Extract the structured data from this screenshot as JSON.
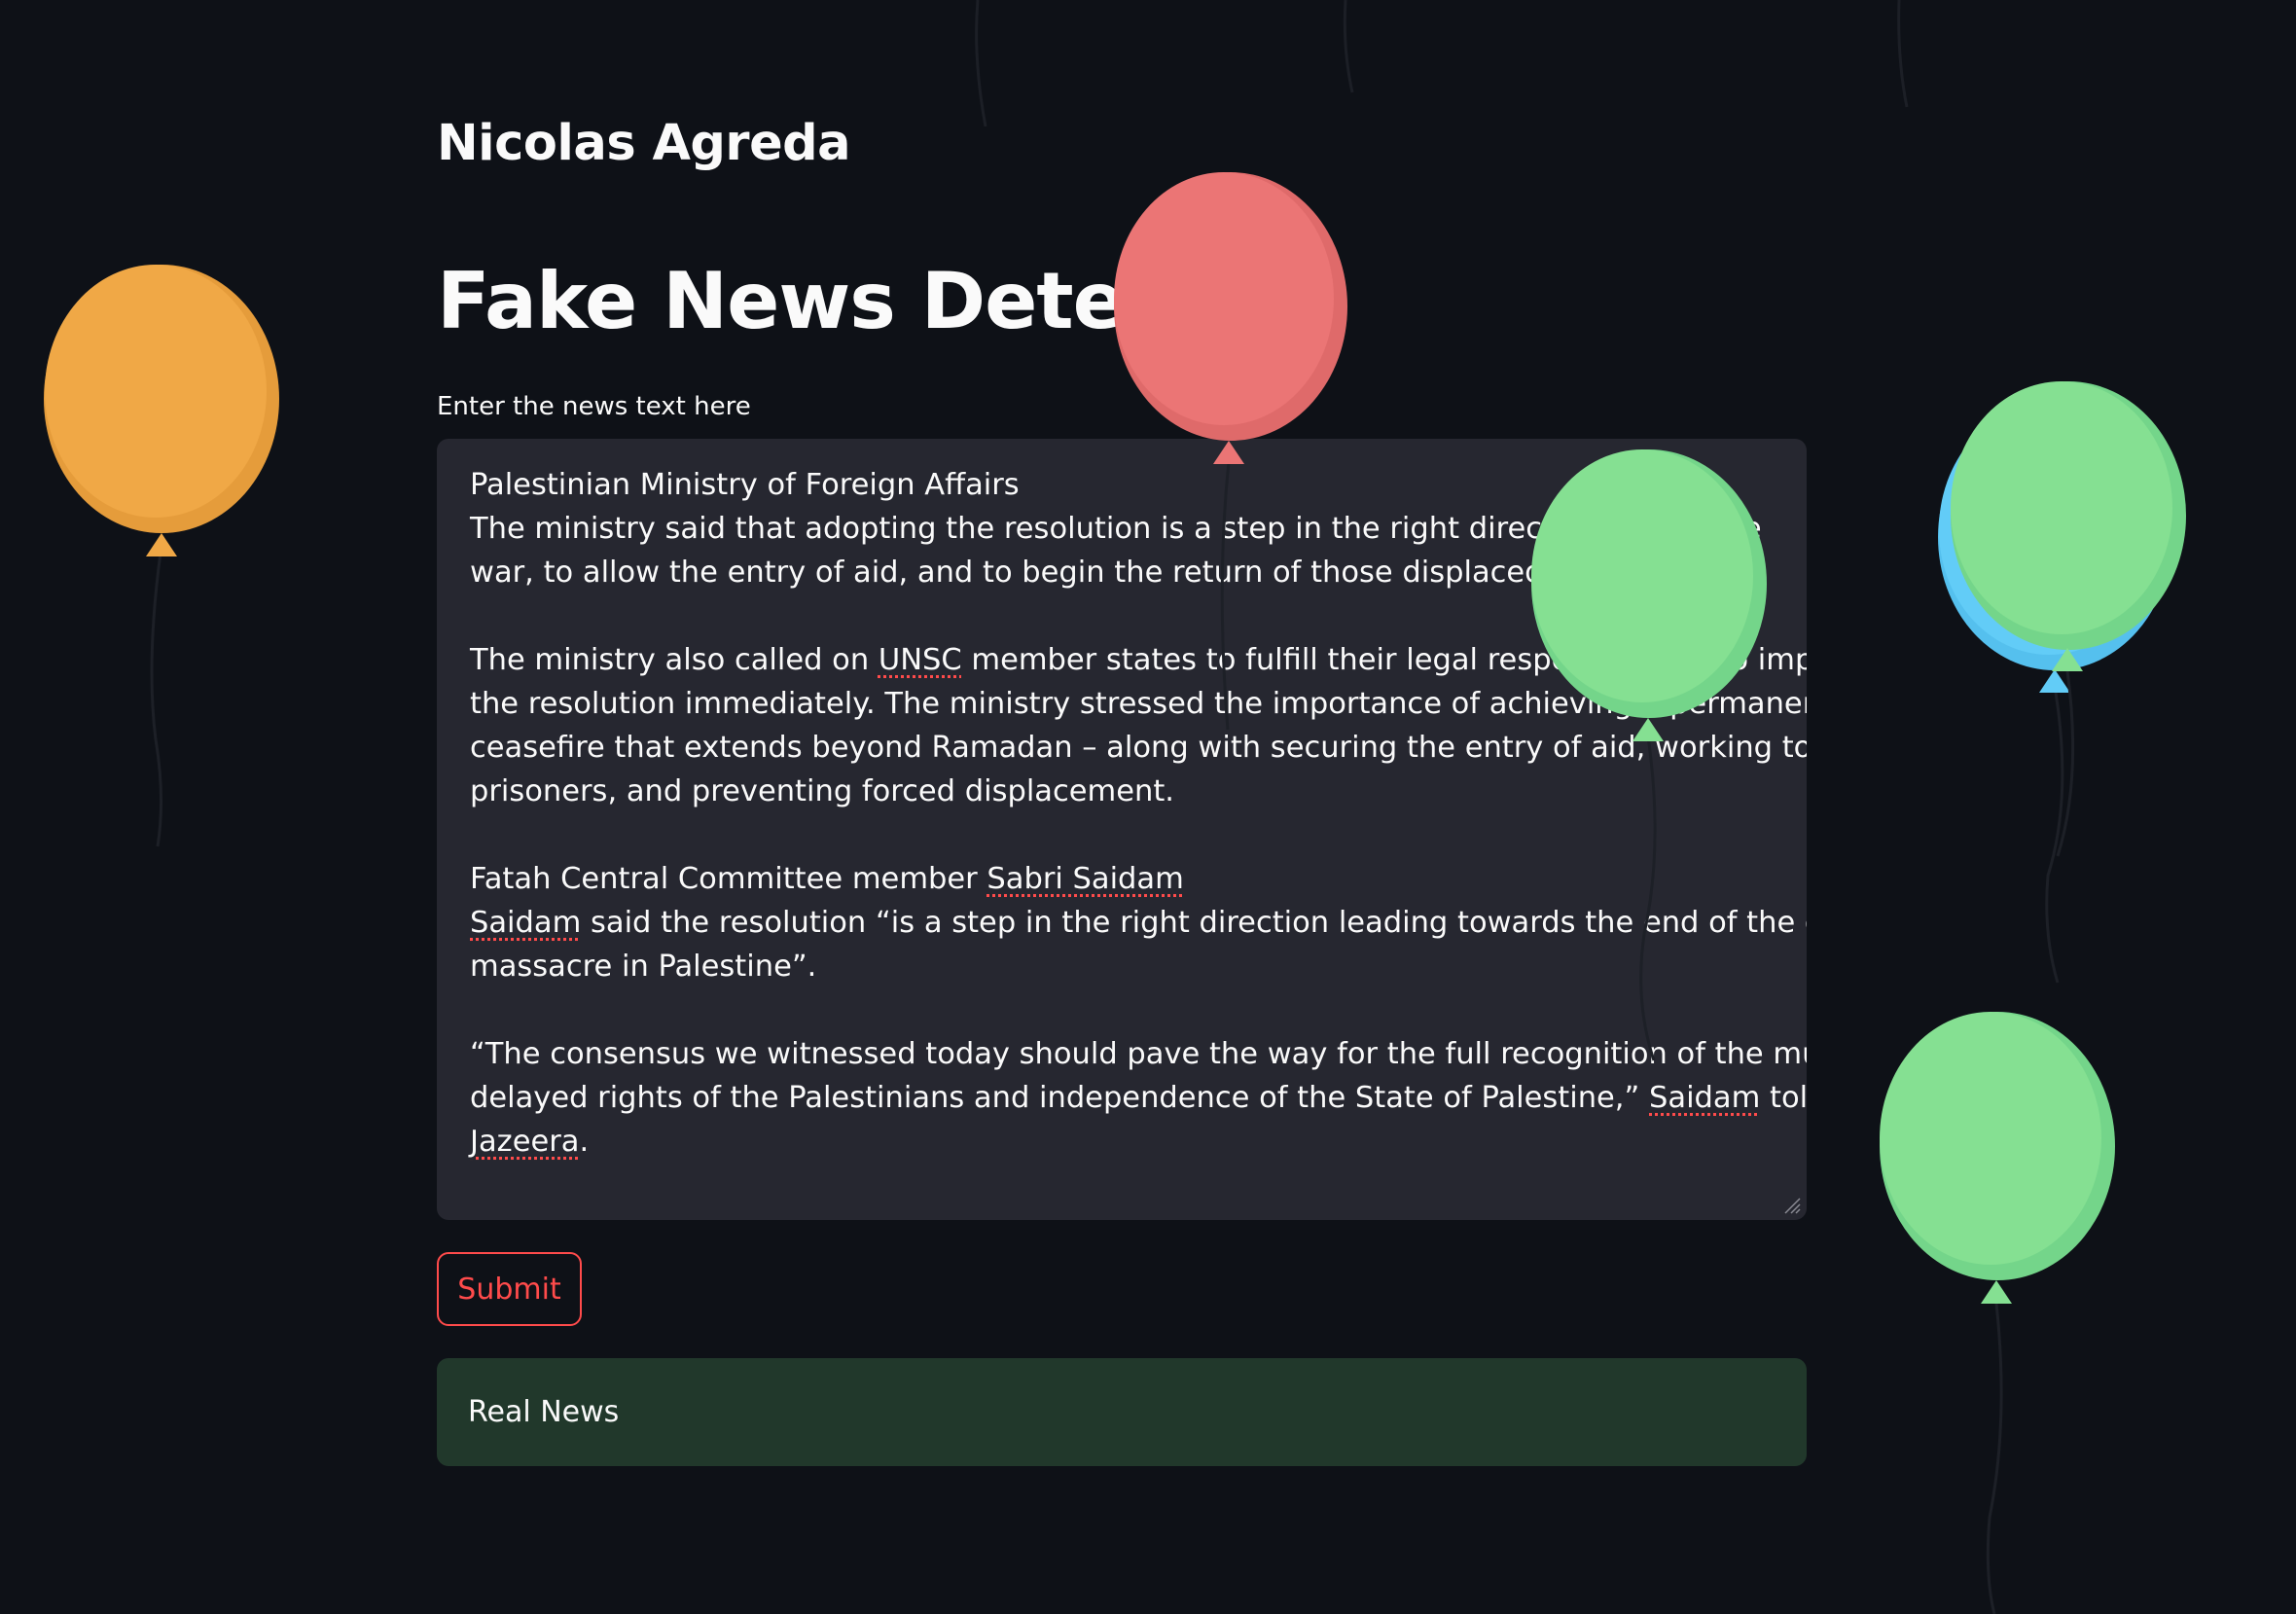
{
  "header": {
    "author": "Nicolas Agreda",
    "title": "Fake News Detection"
  },
  "form": {
    "label": "Enter the news text here",
    "text_lines": {
      "l1": "Palestinian Ministry of Foreign Affairs",
      "l2": "The ministry said that adopting the resolution is a step in the right direction to end the",
      "l3": "war, to allow the entry of aid, and to begin the return of those displaced.",
      "l4a": "The ministry also called on ",
      "l4b": "UNSC",
      "l4c": " member states to fulfill their legal responsibilities to implement",
      "l5": "the resolution immediately. The ministry stressed the importance of achieving a permanent",
      "l6": "ceasefire that extends beyond Ramadan – along with securing the entry of aid, working to release",
      "l7": "prisoners, and preventing forced displacement.",
      "l8a": "Fatah Central Committee member ",
      "l8b": "Sabri Saidam",
      "l9a": "Saidam",
      "l9b": " said the resolution “is a step in the right direction leading towards the end of the ongoing",
      "l10": "massacre in Palestine”.",
      "l11": "“The consensus we witnessed today should pave the way for the full recognition of the much-",
      "l12a": "delayed rights of the Palestinians and independence of the State of Palestine,” ",
      "l12b": "Saidam",
      "l12c": " told Al",
      "l13a": "Jazeera",
      "l13b": "."
    },
    "submit_label": "Submit"
  },
  "result": {
    "text": "Real News",
    "color": "#21382b"
  },
  "colors": {
    "background": "#0e1117",
    "input_bg": "#262730",
    "accent": "#ff4b4b"
  },
  "balloons": [
    "orange",
    "red",
    "green",
    "blue",
    "green",
    "green"
  ]
}
